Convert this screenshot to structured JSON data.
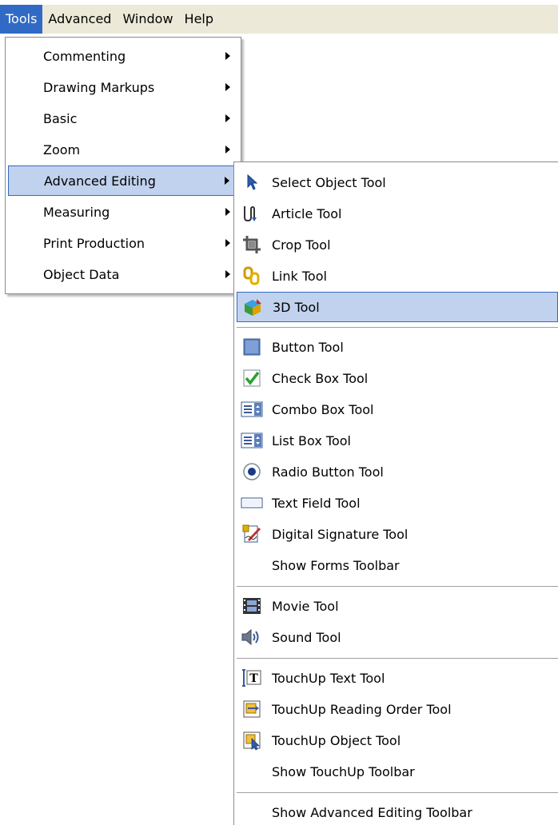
{
  "menubar": {
    "items": [
      "Tools",
      "Advanced",
      "Window",
      "Help"
    ],
    "active_index": 0
  },
  "tools_menu": {
    "items": [
      {
        "label": "Commenting",
        "icon": "none",
        "submenu": true
      },
      {
        "label": "Drawing Markups",
        "icon": "none",
        "submenu": true
      },
      {
        "label": "Basic",
        "icon": "none",
        "submenu": true
      },
      {
        "label": "Zoom",
        "icon": "none",
        "submenu": true
      },
      {
        "label": "Advanced Editing",
        "icon": "none",
        "submenu": true,
        "highlighted": true
      },
      {
        "label": "Measuring",
        "icon": "none",
        "submenu": true
      },
      {
        "label": "Print Production",
        "icon": "none",
        "submenu": true
      },
      {
        "label": "Object Data",
        "icon": "none",
        "submenu": true
      }
    ]
  },
  "advanced_editing_menu": {
    "groups": [
      [
        {
          "label": "Select Object Tool",
          "icon": "select-object-arrow-icon"
        },
        {
          "label": "Article Tool",
          "icon": "article-icon"
        },
        {
          "label": "Crop Tool",
          "icon": "crop-icon"
        },
        {
          "label": "Link Tool",
          "icon": "link-icon"
        },
        {
          "label": "3D Tool",
          "icon": "3d-icon",
          "highlighted": true
        }
      ],
      [
        {
          "label": "Button Tool",
          "icon": "button-icon"
        },
        {
          "label": "Check Box Tool",
          "icon": "checkbox-icon"
        },
        {
          "label": "Combo Box Tool",
          "icon": "combo-box-icon"
        },
        {
          "label": "List Box Tool",
          "icon": "list-box-icon"
        },
        {
          "label": "Radio Button Tool",
          "icon": "radio-button-icon"
        },
        {
          "label": "Text Field Tool",
          "icon": "text-field-icon"
        },
        {
          "label": "Digital Signature Tool",
          "icon": "digital-signature-icon"
        },
        {
          "label": "Show Forms Toolbar",
          "icon": "none"
        }
      ],
      [
        {
          "label": "Movie Tool",
          "icon": "movie-icon"
        },
        {
          "label": "Sound Tool",
          "icon": "sound-icon"
        }
      ],
      [
        {
          "label": "TouchUp Text Tool",
          "icon": "touchup-text-icon"
        },
        {
          "label": "TouchUp Reading Order Tool",
          "icon": "touchup-reading-order-icon"
        },
        {
          "label": "TouchUp Object Tool",
          "icon": "touchup-object-icon"
        },
        {
          "label": "Show TouchUp Toolbar",
          "icon": "none"
        }
      ],
      [
        {
          "label": "Show Advanced Editing Toolbar",
          "icon": "none"
        }
      ]
    ]
  },
  "colors": {
    "menubar_bg": "#ece9d8",
    "menubar_active": "#316ac5",
    "highlight_fill": "#c1d2ee",
    "highlight_border": "#316ac5"
  }
}
